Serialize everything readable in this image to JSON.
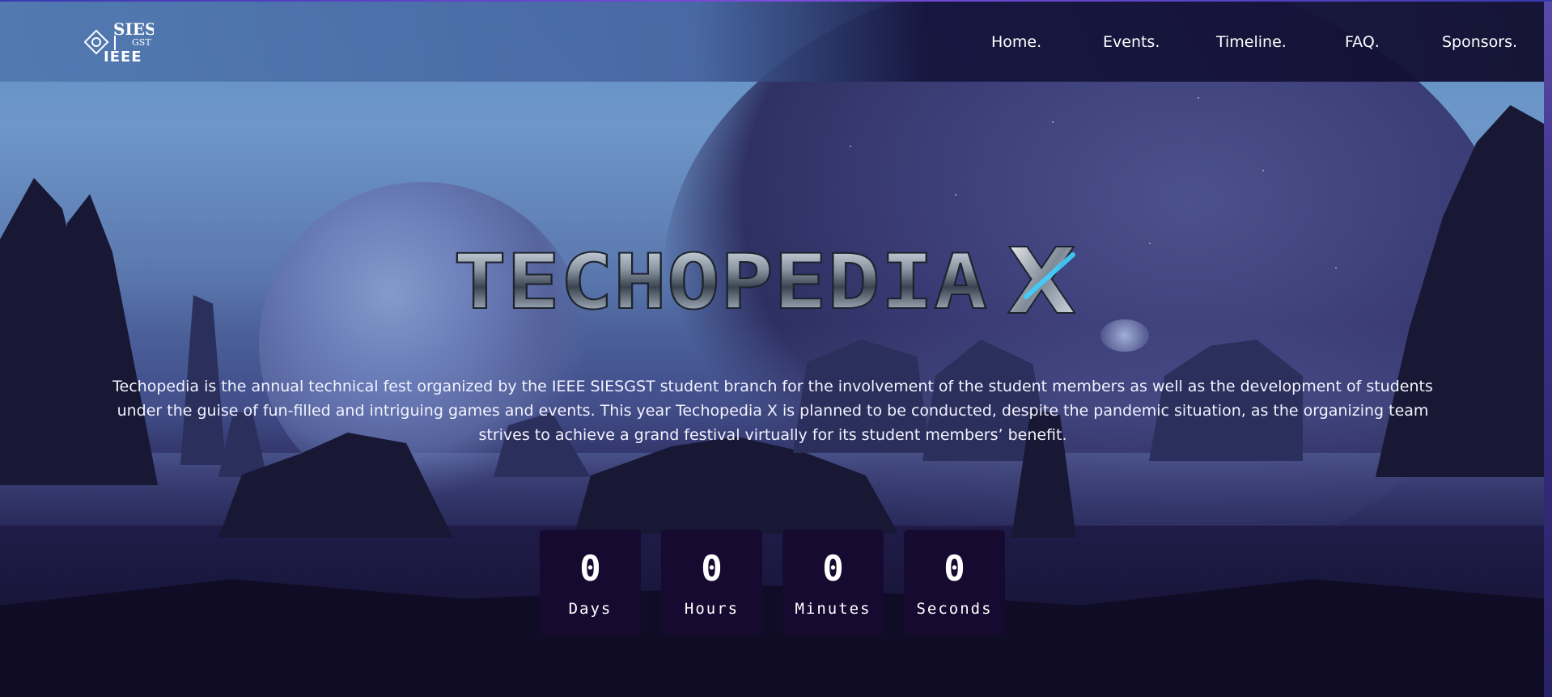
{
  "header": {
    "logo_text": "SIES GST IEEE",
    "nav": [
      {
        "label": "Home."
      },
      {
        "label": "Events."
      },
      {
        "label": "Timeline."
      },
      {
        "label": "FAQ."
      },
      {
        "label": "Sponsors."
      }
    ]
  },
  "hero": {
    "title": "TECHOPEDIA",
    "title_mark": "X",
    "description": "Techopedia is the annual technical fest organized by the IEEE SIESGST student branch for the involvement of the student members as well as the development of students under the guise of fun-filled and intriguing games and events. This year Techopedia X is planned to be conducted, despite the pandemic situation, as the organizing team strives to achieve a grand festival virtually for its student members’ benefit."
  },
  "countdown": [
    {
      "value": "0",
      "label": "Days"
    },
    {
      "value": "0",
      "label": "Hours"
    },
    {
      "value": "0",
      "label": "Minutes"
    },
    {
      "value": "0",
      "label": "Seconds"
    }
  ],
  "colors": {
    "header_left": "#5078af",
    "header_right": "#120e30",
    "countdown_box": "#160a30",
    "title_glow": "#3fd0ff"
  }
}
